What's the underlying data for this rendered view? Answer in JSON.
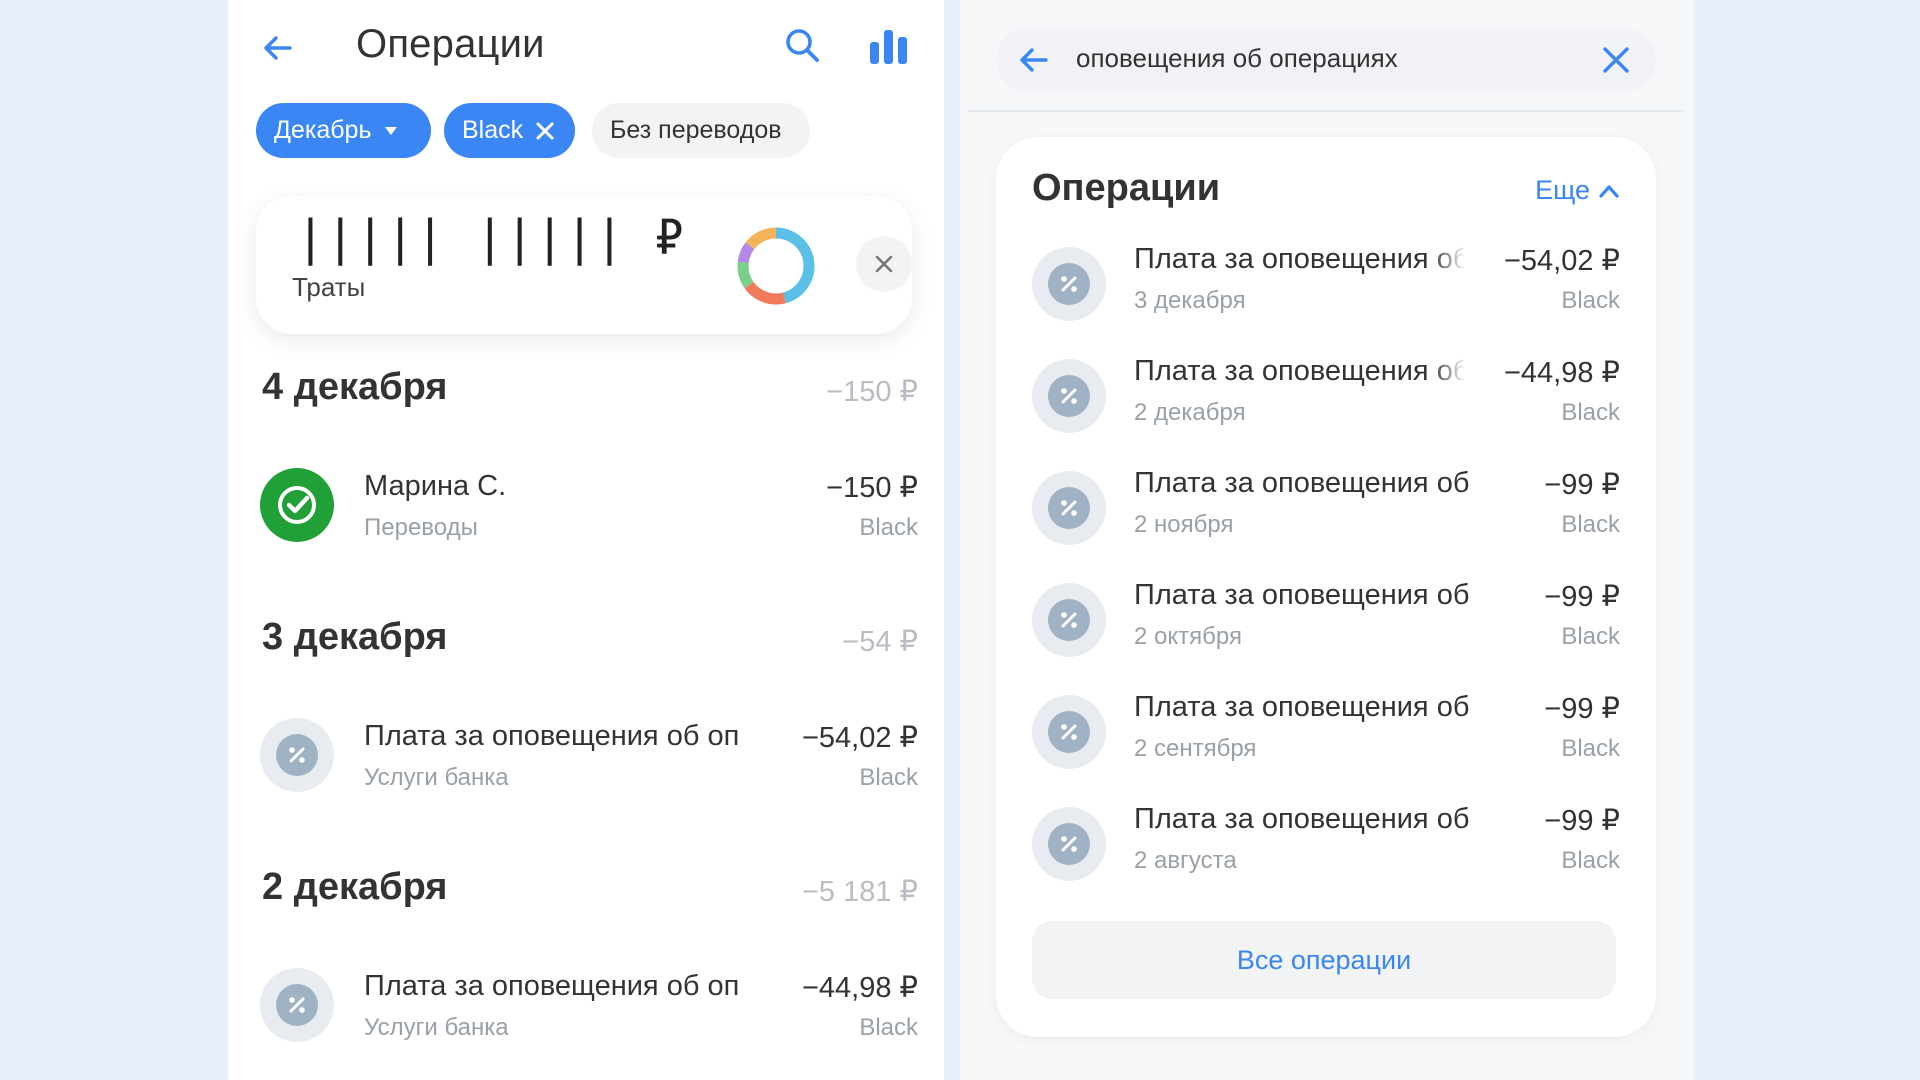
{
  "left": {
    "header": {
      "title": "Операции"
    },
    "filters": [
      {
        "label": "Декабрь"
      },
      {
        "label": "Black"
      },
      {
        "label": "Без переводов"
      }
    ],
    "summary": {
      "amount": "|||||  ||||| ₽",
      "label": "Траты"
    },
    "groups": [
      {
        "date": "4 декабря",
        "total": "−150 ₽",
        "items": [
          {
            "title": "Марина С.",
            "subtitle": "Переводы",
            "amount": "−150 ₽",
            "card": "Black",
            "icon": "check-circle-icon"
          }
        ]
      },
      {
        "date": "3 декабря",
        "total": "−54 ₽",
        "items": [
          {
            "title": "Плата за оповещения об оп",
            "subtitle": "Услуги банка",
            "amount": "−54,02 ₽",
            "card": "Black",
            "icon": "percent-icon"
          }
        ]
      },
      {
        "date": "2 декабря",
        "total": "−5 181 ₽",
        "items": [
          {
            "title": "Плата за оповещения об оп",
            "subtitle": "Услуги банка",
            "amount": "−44,98 ₽",
            "card": "Black",
            "icon": "percent-icon"
          }
        ]
      }
    ]
  },
  "right": {
    "search": {
      "query": "оповещения об операциях"
    },
    "section": {
      "title": "Операции",
      "more_label": "Еще",
      "items": [
        {
          "title": "Плата за оповещения об",
          "date": "3 декабря",
          "amount": "−54,02 ₽",
          "card": "Black"
        },
        {
          "title": "Плата за оповещения об",
          "date": "2 декабря",
          "amount": "−44,98 ₽",
          "card": "Black"
        },
        {
          "title": "Плата за оповещения об",
          "date": "2 ноября",
          "amount": "−99 ₽",
          "card": "Black"
        },
        {
          "title": "Плата за оповещения об",
          "date": "2 октября",
          "amount": "−99 ₽",
          "card": "Black"
        },
        {
          "title": "Плата за оповещения об",
          "date": "2 сентября",
          "amount": "−99 ₽",
          "card": "Black"
        },
        {
          "title": "Плата за оповещения об",
          "date": "2 августа",
          "amount": "−99 ₽",
          "card": "Black"
        }
      ],
      "all_button": "Все операции"
    }
  },
  "colors": {
    "accent": "#3b86f5",
    "success": "#21a038",
    "muted": "#9aa0a7",
    "background": "#e9f0f9"
  }
}
